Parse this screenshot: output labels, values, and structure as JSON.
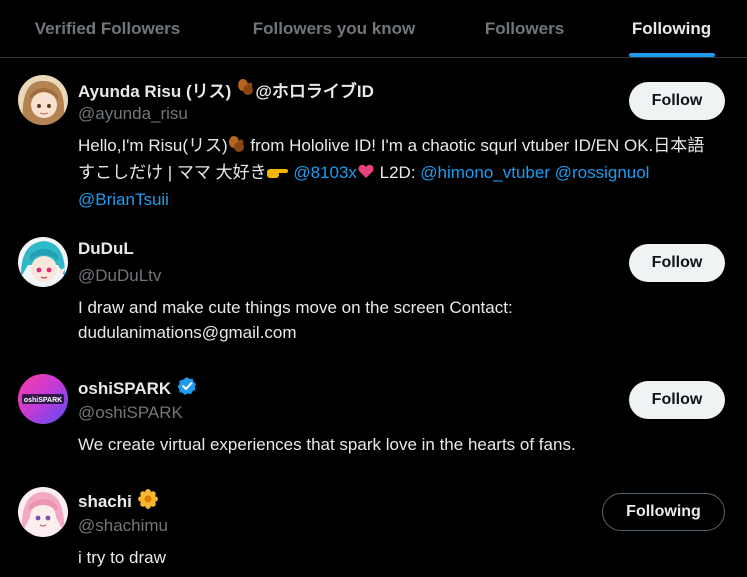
{
  "tabs": [
    {
      "label": "Verified Followers",
      "active": false
    },
    {
      "label": "Followers you know",
      "active": false
    },
    {
      "label": "Followers",
      "active": false
    },
    {
      "label": "Following",
      "active": true
    }
  ],
  "users": [
    {
      "name": "Ayunda Risu (リス)",
      "name_suffix": "@ホロライブID",
      "handle": "@ayunda_risu",
      "bio_1": "Hello,I'm Risu(リス)",
      "bio_2": " from Hololive ID! I'm a chaotic squrl vtuber ID/EN OK.日本語すこしだけ | ママ 大好き",
      "bio_link_1": "@8103x",
      "bio_3": " L2D: ",
      "bio_link_2": "@himono_vtuber",
      "bio_link_3": "@rossignuol",
      "bio_link_4": "@BrianTsuii",
      "button": "Follow"
    },
    {
      "name": "DuDuL",
      "handle": "@DuDuLtv",
      "bio": "I draw and make cute things move on the screen Contact: dudulanimations@gmail.com",
      "button": "Follow"
    },
    {
      "name": "oshiSPARK",
      "handle": "@oshiSPARK",
      "bio": "We create virtual experiences that spark love in the hearts of fans.",
      "button": "Follow",
      "avatar_text": "oshiSPARK"
    },
    {
      "name": "shachi",
      "handle": "@shachimu",
      "bio": "i try to draw",
      "button": "Following"
    }
  ],
  "colors": {
    "background": "#000000",
    "accent": "#1d9bf0",
    "muted": "#71767b",
    "text": "#e7e9ea"
  }
}
